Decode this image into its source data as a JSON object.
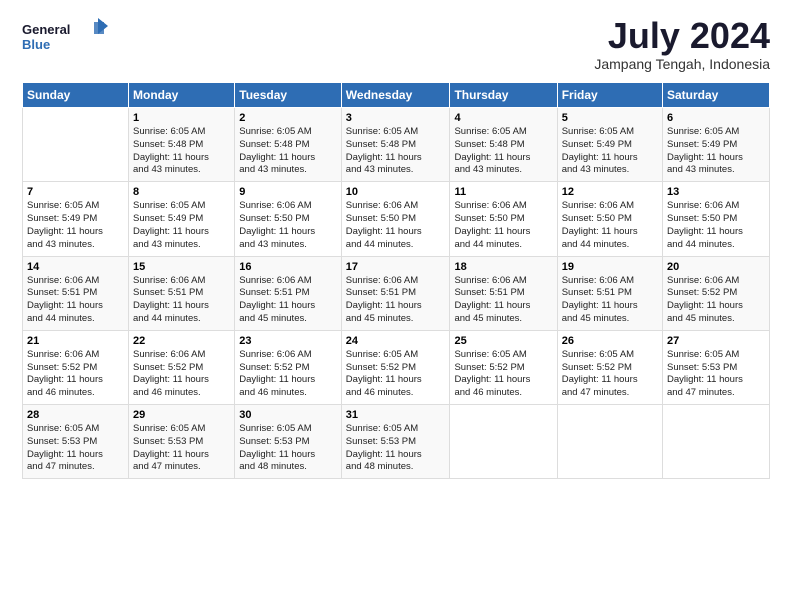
{
  "header": {
    "logo_line1": "General",
    "logo_line2": "Blue",
    "month_year": "July 2024",
    "location": "Jampang Tengah, Indonesia"
  },
  "days_of_week": [
    "Sunday",
    "Monday",
    "Tuesday",
    "Wednesday",
    "Thursday",
    "Friday",
    "Saturday"
  ],
  "weeks": [
    [
      {
        "day": "",
        "info": ""
      },
      {
        "day": "1",
        "info": "Sunrise: 6:05 AM\nSunset: 5:48 PM\nDaylight: 11 hours\nand 43 minutes."
      },
      {
        "day": "2",
        "info": "Sunrise: 6:05 AM\nSunset: 5:48 PM\nDaylight: 11 hours\nand 43 minutes."
      },
      {
        "day": "3",
        "info": "Sunrise: 6:05 AM\nSunset: 5:48 PM\nDaylight: 11 hours\nand 43 minutes."
      },
      {
        "day": "4",
        "info": "Sunrise: 6:05 AM\nSunset: 5:48 PM\nDaylight: 11 hours\nand 43 minutes."
      },
      {
        "day": "5",
        "info": "Sunrise: 6:05 AM\nSunset: 5:49 PM\nDaylight: 11 hours\nand 43 minutes."
      },
      {
        "day": "6",
        "info": "Sunrise: 6:05 AM\nSunset: 5:49 PM\nDaylight: 11 hours\nand 43 minutes."
      }
    ],
    [
      {
        "day": "7",
        "info": "Sunrise: 6:05 AM\nSunset: 5:49 PM\nDaylight: 11 hours\nand 43 minutes."
      },
      {
        "day": "8",
        "info": "Sunrise: 6:05 AM\nSunset: 5:49 PM\nDaylight: 11 hours\nand 43 minutes."
      },
      {
        "day": "9",
        "info": "Sunrise: 6:06 AM\nSunset: 5:50 PM\nDaylight: 11 hours\nand 43 minutes."
      },
      {
        "day": "10",
        "info": "Sunrise: 6:06 AM\nSunset: 5:50 PM\nDaylight: 11 hours\nand 44 minutes."
      },
      {
        "day": "11",
        "info": "Sunrise: 6:06 AM\nSunset: 5:50 PM\nDaylight: 11 hours\nand 44 minutes."
      },
      {
        "day": "12",
        "info": "Sunrise: 6:06 AM\nSunset: 5:50 PM\nDaylight: 11 hours\nand 44 minutes."
      },
      {
        "day": "13",
        "info": "Sunrise: 6:06 AM\nSunset: 5:50 PM\nDaylight: 11 hours\nand 44 minutes."
      }
    ],
    [
      {
        "day": "14",
        "info": "Sunrise: 6:06 AM\nSunset: 5:51 PM\nDaylight: 11 hours\nand 44 minutes."
      },
      {
        "day": "15",
        "info": "Sunrise: 6:06 AM\nSunset: 5:51 PM\nDaylight: 11 hours\nand 44 minutes."
      },
      {
        "day": "16",
        "info": "Sunrise: 6:06 AM\nSunset: 5:51 PM\nDaylight: 11 hours\nand 45 minutes."
      },
      {
        "day": "17",
        "info": "Sunrise: 6:06 AM\nSunset: 5:51 PM\nDaylight: 11 hours\nand 45 minutes."
      },
      {
        "day": "18",
        "info": "Sunrise: 6:06 AM\nSunset: 5:51 PM\nDaylight: 11 hours\nand 45 minutes."
      },
      {
        "day": "19",
        "info": "Sunrise: 6:06 AM\nSunset: 5:51 PM\nDaylight: 11 hours\nand 45 minutes."
      },
      {
        "day": "20",
        "info": "Sunrise: 6:06 AM\nSunset: 5:52 PM\nDaylight: 11 hours\nand 45 minutes."
      }
    ],
    [
      {
        "day": "21",
        "info": "Sunrise: 6:06 AM\nSunset: 5:52 PM\nDaylight: 11 hours\nand 46 minutes."
      },
      {
        "day": "22",
        "info": "Sunrise: 6:06 AM\nSunset: 5:52 PM\nDaylight: 11 hours\nand 46 minutes."
      },
      {
        "day": "23",
        "info": "Sunrise: 6:06 AM\nSunset: 5:52 PM\nDaylight: 11 hours\nand 46 minutes."
      },
      {
        "day": "24",
        "info": "Sunrise: 6:05 AM\nSunset: 5:52 PM\nDaylight: 11 hours\nand 46 minutes."
      },
      {
        "day": "25",
        "info": "Sunrise: 6:05 AM\nSunset: 5:52 PM\nDaylight: 11 hours\nand 46 minutes."
      },
      {
        "day": "26",
        "info": "Sunrise: 6:05 AM\nSunset: 5:52 PM\nDaylight: 11 hours\nand 47 minutes."
      },
      {
        "day": "27",
        "info": "Sunrise: 6:05 AM\nSunset: 5:53 PM\nDaylight: 11 hours\nand 47 minutes."
      }
    ],
    [
      {
        "day": "28",
        "info": "Sunrise: 6:05 AM\nSunset: 5:53 PM\nDaylight: 11 hours\nand 47 minutes."
      },
      {
        "day": "29",
        "info": "Sunrise: 6:05 AM\nSunset: 5:53 PM\nDaylight: 11 hours\nand 47 minutes."
      },
      {
        "day": "30",
        "info": "Sunrise: 6:05 AM\nSunset: 5:53 PM\nDaylight: 11 hours\nand 48 minutes."
      },
      {
        "day": "31",
        "info": "Sunrise: 6:05 AM\nSunset: 5:53 PM\nDaylight: 11 hours\nand 48 minutes."
      },
      {
        "day": "",
        "info": ""
      },
      {
        "day": "",
        "info": ""
      },
      {
        "day": "",
        "info": ""
      }
    ]
  ]
}
